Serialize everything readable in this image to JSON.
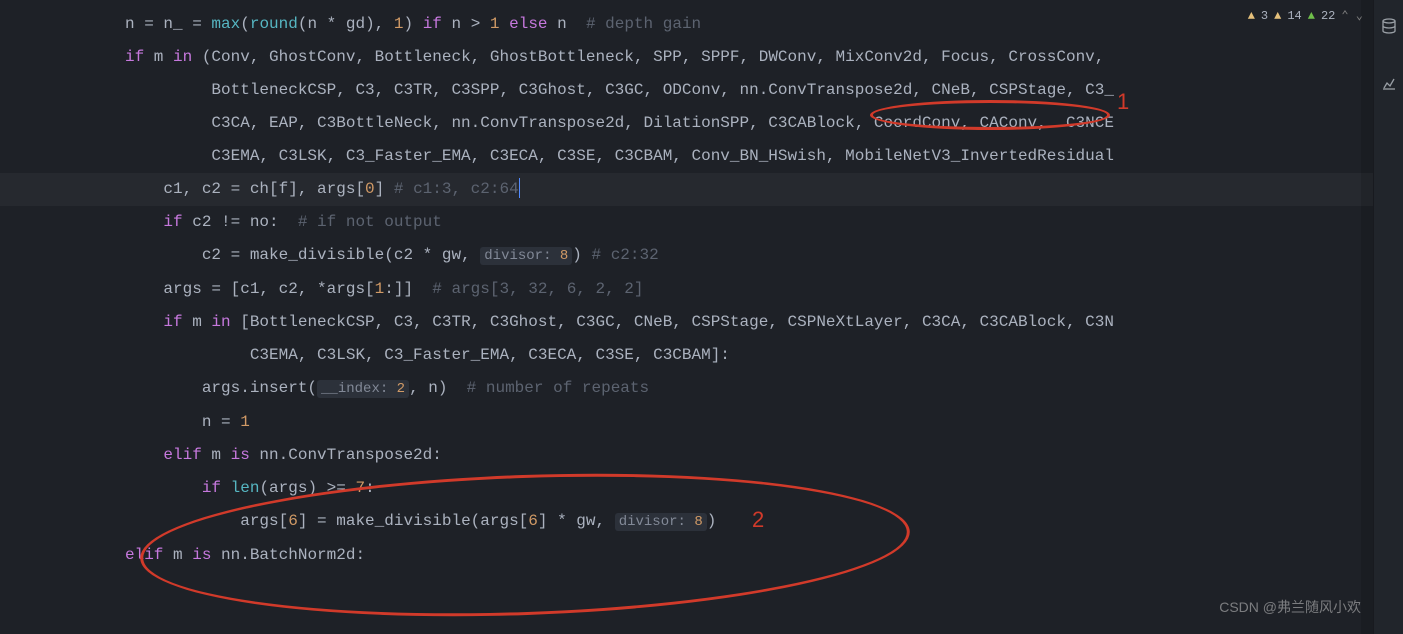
{
  "status": {
    "warn1": "3",
    "warn2": "14",
    "info": "22"
  },
  "code": {
    "l1_a": "n = n_ = ",
    "l1_b": "max",
    "l1_c": "(",
    "l1_d": "round",
    "l1_e": "(n * gd), ",
    "l1_f": "1",
    "l1_g": ") ",
    "l1_h": "if",
    "l1_i": " n > ",
    "l1_j": "1",
    "l1_k": " ",
    "l1_l": "else",
    "l1_m": " n  ",
    "l1_n": "# depth gain",
    "l2_a": "if",
    "l2_b": " m ",
    "l2_c": "in",
    "l2_d": " (Conv, GhostConv, Bottleneck, GhostBottleneck, SPP, SPPF, DWConv, MixConv2d, Focus, CrossConv,",
    "l3": "         BottleneckCSP, C3, C3TR, C3SPP, C3Ghost, C3GC, ODConv, nn.ConvTranspose2d, CNeB, CSPStage, C3_",
    "l4": "         C3CA, EAP, C3BottleNeck, nn.ConvTranspose2d, DilationSPP, C3CABlock, CoordConv, CAConv,  C3NCE",
    "l5": "         C3EMA, C3LSK, C3_Faster_EMA, C3ECA, C3SE, C3CBAM, Conv_BN_HSwish, MobileNetV3_InvertedResidual",
    "l6_a": "    c1, c2 = ch[f], args[",
    "l6_b": "0",
    "l6_c": "] ",
    "l6_d": "# c1:3, c2:64",
    "l7_a": "    ",
    "l7_b": "if",
    "l7_c": " c2 != no:  ",
    "l7_d": "# if not output",
    "l8_a": "        c2 = make_divisible(c2 * gw, ",
    "l8_hint": "divisor: ",
    "l8_hv": "8",
    "l8_b": ") ",
    "l8_c": "# c2:32",
    "l9": "",
    "l10_a": "    args = [c1, c2, *args[",
    "l10_b": "1",
    "l10_c": ":]]  ",
    "l10_d": "# args[3, 32, 6, 2, 2]",
    "l11_a": "    ",
    "l11_b": "if",
    "l11_c": " m ",
    "l11_d": "in",
    "l11_e": " [BottleneckCSP, C3, C3TR, C3Ghost, C3GC, CNeB, CSPStage, CSPNeXtLayer, C3CA, C3CABlock, C3N",
    "l12": "             C3EMA, C3LSK, C3_Faster_EMA, C3ECA, C3SE, C3CBAM]:",
    "l13_a": "        args.insert(",
    "l13_hint": "__index: ",
    "l13_hv": "2",
    "l13_b": ", n)  ",
    "l13_c": "# number of repeats",
    "l14_a": "        n = ",
    "l14_b": "1",
    "l15_a": "    ",
    "l15_b": "elif",
    "l15_c": " m ",
    "l15_d": "is",
    "l15_e": " nn.ConvTranspose2d:",
    "l16_a": "        ",
    "l16_b": "if",
    "l16_c": " ",
    "l16_d": "len",
    "l16_e": "(args) >= ",
    "l16_f": "7",
    "l16_g": ":",
    "l17_a": "            args[",
    "l17_b": "6",
    "l17_c": "] = make_divisible(args[",
    "l17_d": "6",
    "l17_e": "] * gw, ",
    "l17_hint": "divisor: ",
    "l17_hv": "8",
    "l17_f": ")",
    "l18_a": "elif",
    "l18_b": " m ",
    "l18_c": "is",
    "l18_d": " nn.BatchNorm2d:"
  },
  "annotation": {
    "label1": "1",
    "label2": "2"
  },
  "watermark": "CSDN @弗兰随风小欢"
}
